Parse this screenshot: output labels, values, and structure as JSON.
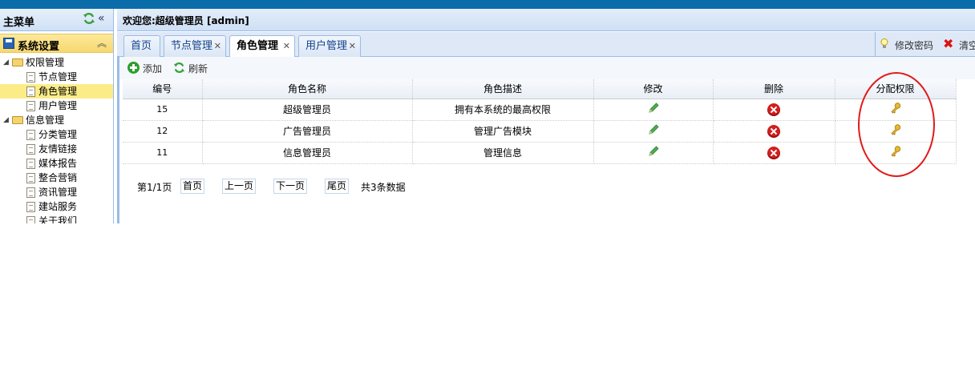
{
  "sidebar": {
    "title": "主菜单",
    "section": "系统设置",
    "tree": [
      {
        "label": "权限管理",
        "type": "folder",
        "level": 0
      },
      {
        "label": "节点管理",
        "type": "doc",
        "level": 1
      },
      {
        "label": "角色管理",
        "type": "doc",
        "level": 1,
        "selected": true
      },
      {
        "label": "用户管理",
        "type": "doc",
        "level": 1
      },
      {
        "label": "信息管理",
        "type": "folder",
        "level": 0
      },
      {
        "label": "分类管理",
        "type": "doc",
        "level": 1
      },
      {
        "label": "友情链接",
        "type": "doc",
        "level": 1
      },
      {
        "label": "媒体报告",
        "type": "doc",
        "level": 1
      },
      {
        "label": "整合营销",
        "type": "doc",
        "level": 1
      },
      {
        "label": "资讯管理",
        "type": "doc",
        "level": 1
      },
      {
        "label": "建站服务",
        "type": "doc",
        "level": 1
      },
      {
        "label": "关于我们",
        "type": "doc",
        "level": 1
      }
    ]
  },
  "header": {
    "welcome": "欢迎您:超级管理员 [admin]"
  },
  "tabs": [
    {
      "label": "首页",
      "closable": false
    },
    {
      "label": "节点管理",
      "closable": true
    },
    {
      "label": "角色管理",
      "closable": true,
      "active": true
    },
    {
      "label": "用户管理",
      "closable": true
    }
  ],
  "tools": {
    "change_password": "修改密码",
    "clear": "清空"
  },
  "toolbar": {
    "add": "添加",
    "refresh": "刷新"
  },
  "table": {
    "columns": [
      "编号",
      "角色名称",
      "角色描述",
      "修改",
      "删除",
      "分配权限"
    ],
    "rows": [
      {
        "id": "15",
        "name": "超级管理员",
        "desc": "拥有本系统的最高权限"
      },
      {
        "id": "12",
        "name": "广告管理员",
        "desc": "管理广告模块"
      },
      {
        "id": "11",
        "name": "信息管理员",
        "desc": "管理信息"
      }
    ]
  },
  "pager": {
    "page_info": "第1/1页",
    "first": "首页",
    "prev": "上一页",
    "next": "下一页",
    "last": "尾页",
    "total": "共3条数据"
  },
  "colors": {
    "topbar": "#0a6ca8",
    "border": "#99bbe8",
    "selected": "#fbec88",
    "annotation": "#e01b1b"
  }
}
